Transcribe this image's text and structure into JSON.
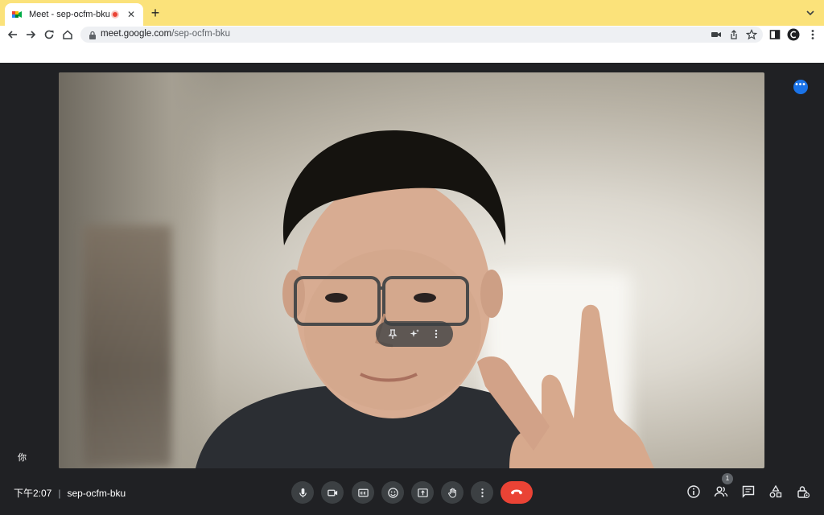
{
  "browser": {
    "tab": {
      "title": "Meet - sep-ocfm-bku",
      "close": "✕"
    },
    "new_tab": "+",
    "address": {
      "host": "meet.google.com",
      "path": "/sep-ocfm-bku"
    }
  },
  "meeting": {
    "self_label": "你",
    "time": "下午2:07",
    "code": "sep-ocfm-bku",
    "participant_count": "1",
    "more_bubble": "•••"
  },
  "colors": {
    "tabstrip": "#fbe27a",
    "meet_bg": "#202124",
    "hangup": "#ea4335",
    "accent": "#1a73e8"
  }
}
